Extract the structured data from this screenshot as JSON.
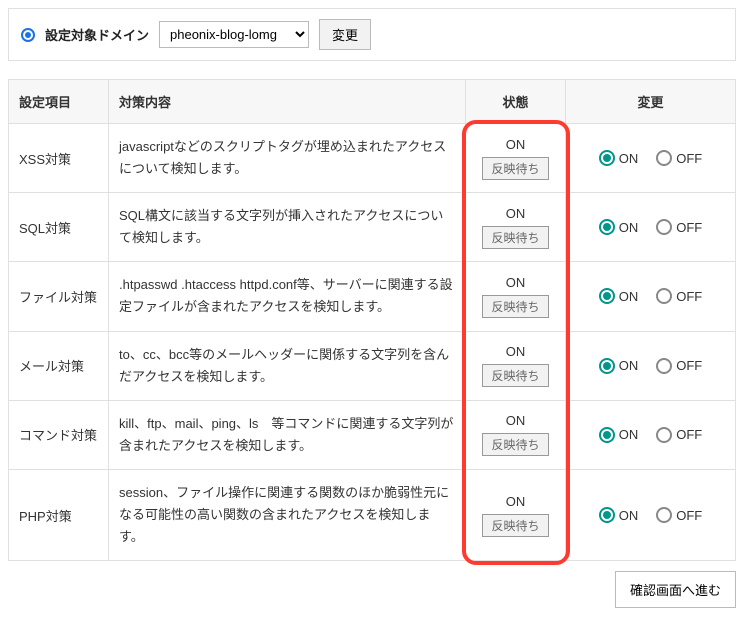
{
  "domainBar": {
    "label": "設定対象ドメイン",
    "selected": "pheonix-blog-lomg",
    "changeBtn": "変更"
  },
  "headers": {
    "item": "設定項目",
    "desc": "対策内容",
    "status": "状態",
    "change": "変更"
  },
  "statusLabels": {
    "on": "ON",
    "pending": "反映待ち"
  },
  "radioLabels": {
    "on": "ON",
    "off": "OFF"
  },
  "rows": [
    {
      "item": "XSS対策",
      "desc": "javascriptなどのスクリプトタグが埋め込まれたアクセスについて検知します。"
    },
    {
      "item": "SQL対策",
      "desc": "SQL構文に該当する文字列が挿入されたアクセスについて検知します。"
    },
    {
      "item": "ファイル対策",
      "desc": ".htpasswd .htaccess httpd.conf等、サーバーに関連する設定ファイルが含まれたアクセスを検知します。"
    },
    {
      "item": "メール対策",
      "desc": "to、cc、bcc等のメールヘッダーに関係する文字列を含んだアクセスを検知します。"
    },
    {
      "item": "コマンド対策",
      "desc": "kill、ftp、mail、ping、ls　等コマンドに関連する文字列が含まれたアクセスを検知します。"
    },
    {
      "item": "PHP対策",
      "desc": "session、ファイル操作に関連する関数のほか脆弱性元になる可能性の高い関数の含まれたアクセスを検知します。"
    }
  ],
  "footer": {
    "confirm": "確認画面へ進む"
  }
}
